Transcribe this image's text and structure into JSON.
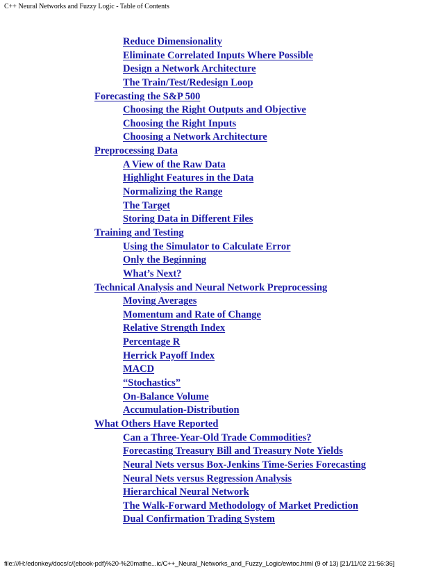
{
  "header": {
    "title": "C++ Neural Networks and Fuzzy Logic - Table of Contents"
  },
  "toc": {
    "link_color": "#1a1aa6",
    "entries": [
      {
        "level": 2,
        "label": "Reduce Dimensionality"
      },
      {
        "level": 2,
        "label": "Eliminate Correlated Inputs Where Possible"
      },
      {
        "level": 2,
        "label": "Design a Network Architecture"
      },
      {
        "level": 2,
        "label": "The Train/Test/Redesign Loop"
      },
      {
        "level": 1,
        "label": "Forecasting the S&P 500"
      },
      {
        "level": 2,
        "label": "Choosing the Right Outputs and Objective"
      },
      {
        "level": 2,
        "label": "Choosing the Right Inputs"
      },
      {
        "level": 2,
        "label": "Choosing a Network Architecture"
      },
      {
        "level": 1,
        "label": "Preprocessing Data"
      },
      {
        "level": 2,
        "label": "A View of the Raw Data"
      },
      {
        "level": 2,
        "label": "Highlight Features in the Data"
      },
      {
        "level": 2,
        "label": "Normalizing the Range"
      },
      {
        "level": 2,
        "label": "The Target"
      },
      {
        "level": 2,
        "label": "Storing Data in Different Files"
      },
      {
        "level": 1,
        "label": "Training and Testing"
      },
      {
        "level": 2,
        "label": "Using the Simulator to Calculate Error"
      },
      {
        "level": 2,
        "label": "Only the Beginning"
      },
      {
        "level": 2,
        "label": "What’s Next?"
      },
      {
        "level": 1,
        "label": "Technical Analysis and Neural Network Preprocessing"
      },
      {
        "level": 2,
        "label": "Moving Averages"
      },
      {
        "level": 2,
        "label": "Momentum and Rate of Change"
      },
      {
        "level": 2,
        "label": "Relative Strength Index"
      },
      {
        "level": 2,
        "label": "Percentage R"
      },
      {
        "level": 2,
        "label": "Herrick Payoff Index"
      },
      {
        "level": 2,
        "label": "MACD"
      },
      {
        "level": 2,
        "label": "“Stochastics”"
      },
      {
        "level": 2,
        "label": "On-Balance Volume"
      },
      {
        "level": 2,
        "label": "Accumulation-Distribution"
      },
      {
        "level": 1,
        "label": "What Others Have Reported"
      },
      {
        "level": 2,
        "label": "Can a Three-Year-Old Trade Commodities?"
      },
      {
        "level": 2,
        "label": "Forecasting Treasury Bill and Treasury Note Yields"
      },
      {
        "level": 2,
        "label": "Neural Nets versus Box-Jenkins Time-Series Forecasting"
      },
      {
        "level": 2,
        "label": "Neural Nets versus Regression Analysis"
      },
      {
        "level": 2,
        "label": "Hierarchical Neural Network"
      },
      {
        "level": 2,
        "label": "The Walk-Forward Methodology of Market Prediction"
      },
      {
        "level": 2,
        "label": "Dual Confirmation Trading System"
      }
    ]
  },
  "footer": {
    "path": "file:///H:/edonkey/docs/c/(ebook-pdf)%20-%20mathe...ic/C++_Neural_Networks_and_Fuzzy_Logic/ewtoc.html (9 of 13) [21/11/02 21:56:36]"
  }
}
